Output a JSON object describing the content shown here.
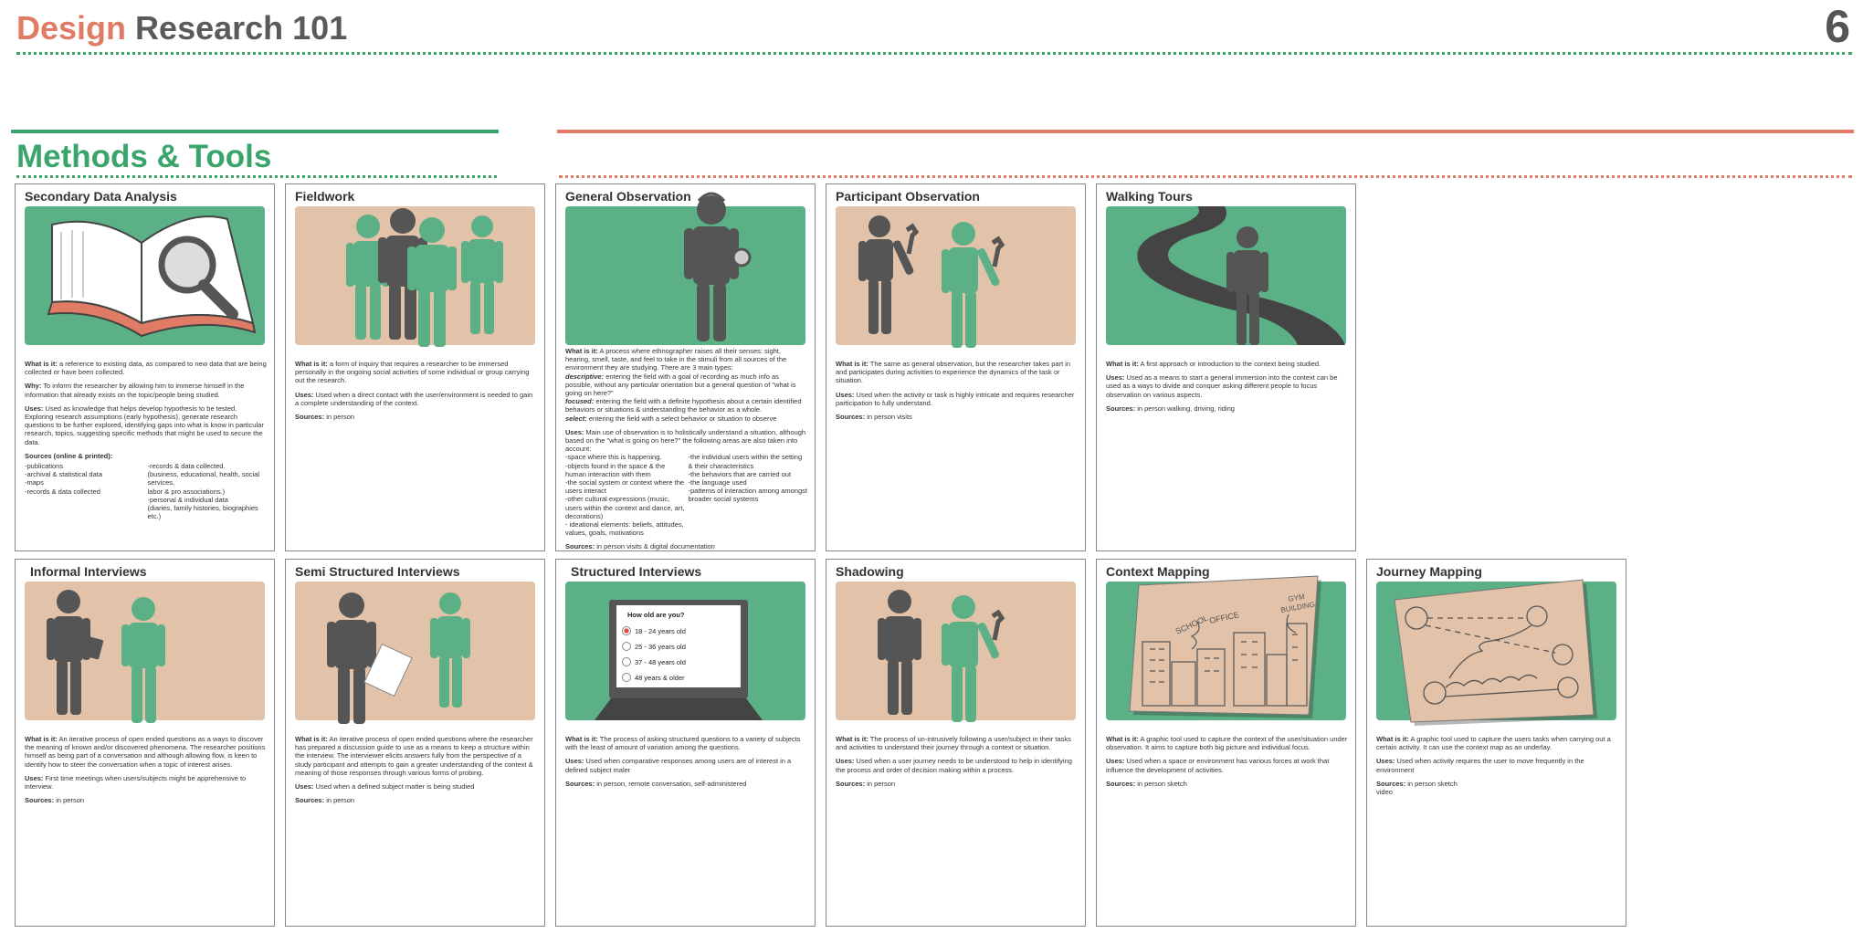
{
  "header": {
    "title_part1": "Design",
    "title_part2": "Research 101",
    "page_number": "6"
  },
  "section_title": "Methods & Tools",
  "colors": {
    "green": "#3aa56b",
    "coral": "#e07b65",
    "illo_green": "#5bb185",
    "illo_tan": "#e2c2a8",
    "figure_dark": "#555555"
  },
  "cards": {
    "secondary": {
      "title": "Secondary Data Analysis",
      "what": "a reference to existing data, as compared to new data that are being collected or have been collected.",
      "why": "To inform the researcher by allowing him to immerse himself in the information that already exists on the topic/people being studied.",
      "uses": "Used as knowledge that helps develop hypothesis to be tested. Exploring research assumptions (early hypothesis), generate research questions to be further explored, identifying gaps into what is know in particular research, topics, suggesting specific methods that might be used to secure the data.",
      "sources_label": "Sources (online & printed):",
      "sources_left": [
        "-publications",
        "-archival & statistical data",
        "-maps",
        "-records & data collected"
      ],
      "sources_right": [
        "-records & data collected.",
        " (business, educational, health, social services,",
        " labor & pro associations.)",
        "-personal & individual data",
        " (diaries, family histories, biographies etc.)"
      ]
    },
    "fieldwork": {
      "title": "Fieldwork",
      "what": "a form of inquiry that requires a researcher to be immersed personally in the ongoing social activities of some individual or group carrying out the research.",
      "uses": "Used when a direct contact with the user/environment is needed to gain a complete understanding of the context.",
      "sources": "in person"
    },
    "general": {
      "title": "General Observation",
      "what": "A process where ethnographer raises all their senses: sight, hearing, smell, taste, and feel to take in the stimuli from all sources of the environment they are studying. There are 3 main types:",
      "descriptive": "entering the field with a goal of recording as much info as possible, without any particular orientation but a general question of \"what is going on here?\"",
      "focused": "entering the field with a definite hypothesis about a certain identified behaviors or situations & understanding the behavior as a whole.",
      "select": "entering the field with a select behavior or situation to observe",
      "uses": "Main use of observation is to holistically understand a situation, although based on the \"what is going on here?\" the following areas are also taken into account:",
      "list_left": [
        "-space where this is happening.",
        "-objects found in the space & the human interaction with them",
        "-the social system or context where the users interact",
        "-other cultural expressions (music, users within the context and dance, art, decorations)",
        "- ideational elements: beliefs, attitudes, values, goals, motivations"
      ],
      "list_right": [
        "-the individual users within the setting & their characteristics",
        "-the behaviors that are carried out",
        "-the language used",
        "-patterns of interaction among amongst broader social systems"
      ],
      "sources": "in person visits & digital documentation"
    },
    "participant": {
      "title": "Participant Observation",
      "what": "The same as general observation, but the researcher takes part in and participates during activities to experience the dynamics of the task or situation.",
      "uses": "Used when the activity or task is highly intricate and requires researcher participation to fully understand.",
      "sources": "in person visits"
    },
    "walking": {
      "title": "Walking Tours",
      "what": "A first approach or introduction to the context being studied.",
      "uses": "Used as a means to start a general immersion into the context can be used as a ways to divide and conquer asking different people to focus observation on various aspects.",
      "sources": "in person walking, driving, riding"
    },
    "informal": {
      "title": "Informal Interviews",
      "what": "An iterative process of open ended questions as a ways to discover the meaning of known and/or discovered phenomena. The researcher positions himself as being part of a conversation and although allowing flow, is keen to identify how to steer the conversation when a topic of interest arises.",
      "uses": "First time meetings when users/subjects might be apprehensive to interview.",
      "sources": "in person"
    },
    "semi": {
      "title": "Semi Structured Interviews",
      "what": "An iterative process of open ended questions where the researcher has prepared a discussion guide to use as a means to keep a structure within the interview. The interviewer elicits answers fully from the perspective of a study participant and attempts to gain a greater understanding of the context & meaning of those responses through various forms of probing.",
      "uses": "Used when a defined subject matter is being studied",
      "sources": "in person"
    },
    "structured": {
      "title": "Structured Interviews",
      "what": "The process of asking structured questions to a variety of subjects with the least of amount of variation among the questions.",
      "uses": "Used when comparative responses among users are of interest in a defined subject maler",
      "sources": "in person, remote conversation, self-administered",
      "survey_question": "How old are you?",
      "survey_options": [
        "18 - 24 years old",
        "25 - 36 years old",
        "37 - 48 years old",
        "48 years & older"
      ]
    },
    "shadowing": {
      "title": "Shadowing",
      "what": "The process of un-intrusively following a user/subject in their tasks and activities to understand their journey through a context or situation.",
      "uses": "Used when a  user journey needs to be understood to help in identifying the process and order of decision making within a process.",
      "sources": "in person"
    },
    "context": {
      "title": "Context Mapping",
      "what": "A graphic tool used to capture the context of the user/situation under observation. It aims to capture both big picture and individual focus.",
      "uses": "Used when a space or environment has various forces at work that influence the development of activities.",
      "sources": "in person sketch",
      "map_labels": [
        "SCHOOL",
        "OFFICE",
        "GYM",
        "BUILDING"
      ]
    },
    "journey": {
      "title": "Journey Mapping",
      "what": "A graphic tool used  to capture the users tasks when carrying out a certain activity. It can use the context map as an underlay.",
      "uses": "Used when activity requires the user to move frequently in the environment",
      "sources": "in person sketch",
      "sources_extra": "video"
    }
  },
  "labels": {
    "what": "What is it:",
    "why": "Why:",
    "uses": "Uses:",
    "sources": "Sources:",
    "descriptive": "descriptive:",
    "focused": "focused:",
    "select": "select:"
  }
}
